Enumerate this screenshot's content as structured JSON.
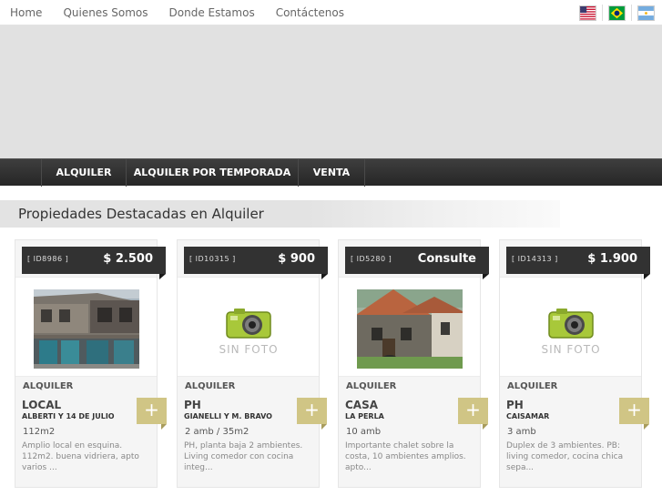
{
  "nav": {
    "links": [
      "Home",
      "Quienes Somos",
      "Donde Estamos",
      "Contáctenos"
    ],
    "flags": [
      "usa-flag-icon",
      "brazil-flag-icon",
      "argentina-flag-icon"
    ]
  },
  "categories": [
    "ALQUILER",
    "ALQUILER POR TEMPORADA",
    "VENTA"
  ],
  "section": {
    "title": "Propiedades Destacadas en Alquiler"
  },
  "no_photo_label": "SIN FOTO",
  "colors": {
    "accent": "#d0c585",
    "dark_bar": "#2e2e2e",
    "ribbon": "#323232"
  },
  "properties": [
    {
      "id": "[ ID8986 ]",
      "price": "$ 2.500",
      "has_photo": true,
      "operation": "ALQUILER",
      "kind": "LOCAL",
      "address": "ALBERTI Y 14 DE JULIO",
      "detail": "112m2",
      "desc": "Amplio local en esquina. 112m2. buena vidriera, apto varios ..."
    },
    {
      "id": "[ ID10315 ]",
      "price": "$ 900",
      "has_photo": false,
      "operation": "ALQUILER",
      "kind": "PH",
      "address": "GIANELLI Y M. BRAVO",
      "detail": "2 amb / 35m2",
      "desc": "PH, planta baja 2 ambientes. Living comedor con cocina integ..."
    },
    {
      "id": "[ ID5280 ]",
      "price": "Consulte",
      "has_photo": true,
      "operation": "ALQUILER",
      "kind": "CASA",
      "address": "LA PERLA",
      "detail": "10 amb",
      "desc": "Importante chalet sobre la costa, 10 ambientes amplios. apto..."
    },
    {
      "id": "[ ID14313 ]",
      "price": "$ 1.900",
      "has_photo": false,
      "operation": "ALQUILER",
      "kind": "PH",
      "address": "CAISAMAR",
      "detail": "3 amb",
      "desc": "Duplex de 3 ambientes. PB: living comedor, cocina chica sepa..."
    }
  ]
}
